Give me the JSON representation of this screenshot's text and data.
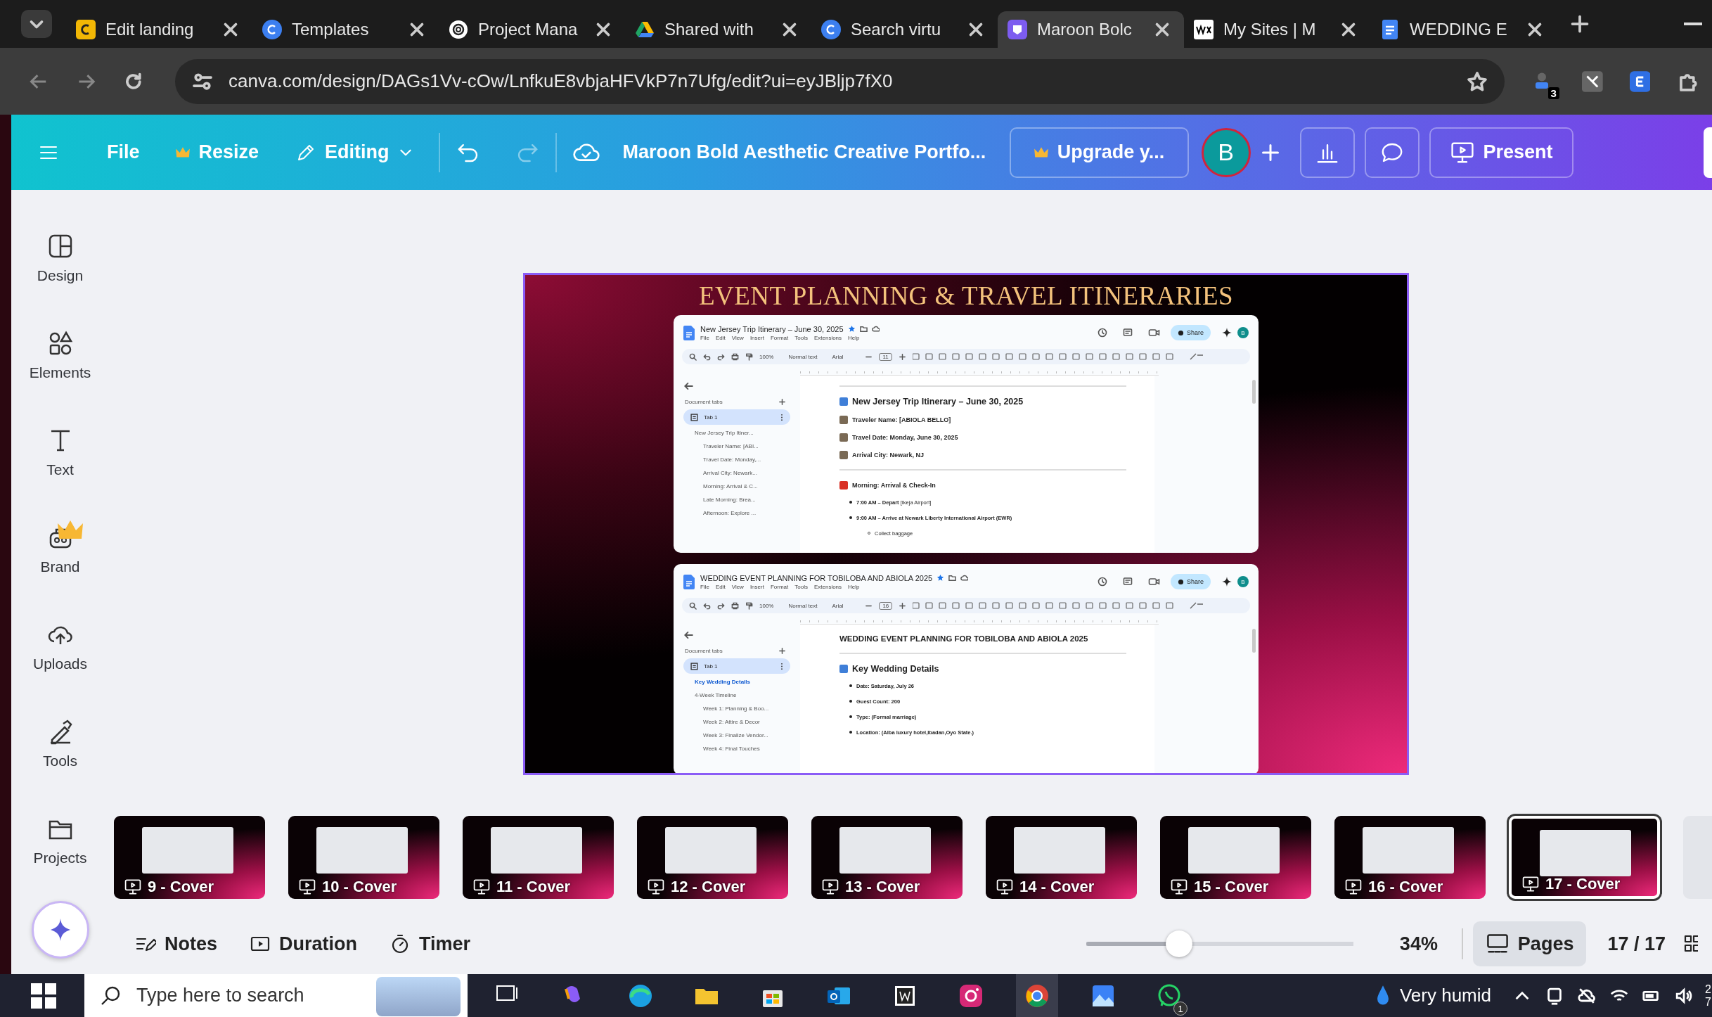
{
  "browser": {
    "tabs": [
      {
        "title": "Edit landing",
        "kind": "gold",
        "selected": false
      },
      {
        "title": "Templates",
        "kind": "canva",
        "selected": false
      },
      {
        "title": "Project Mana",
        "kind": "openai",
        "selected": false
      },
      {
        "title": "Shared with",
        "kind": "drive",
        "selected": false
      },
      {
        "title": "Search virtu",
        "kind": "canva",
        "selected": false
      },
      {
        "title": "Maroon Bolc",
        "kind": "design",
        "selected": true
      },
      {
        "title": "My Sites | M",
        "kind": "wix",
        "selected": false
      },
      {
        "title": "WEDDING E",
        "kind": "docs",
        "selected": false
      }
    ],
    "address": "canva.com/design/DAGs1Vv-cOw/LnfkuE8vbjaHFVkP7n7Ufg/edit?ui=eyJBljp7fX0",
    "extension_badge": "3"
  },
  "toolbar": {
    "file": "File",
    "resize": "Resize",
    "editing": "Editing",
    "title": "Maroon Bold Aesthetic Creative Portfo...",
    "upgrade": "Upgrade y...",
    "avatar": "B",
    "present": "Present"
  },
  "sidebar": {
    "items": [
      {
        "label": "Design",
        "kind": "design",
        "premium": false
      },
      {
        "label": "Elements",
        "kind": "elements",
        "premium": false
      },
      {
        "label": "Text",
        "kind": "text",
        "premium": false
      },
      {
        "label": "Brand",
        "kind": "brand",
        "premium": true
      },
      {
        "label": "Uploads",
        "kind": "uploads",
        "premium": false
      },
      {
        "label": "Tools",
        "kind": "tools",
        "premium": false
      },
      {
        "label": "Projects",
        "kind": "projects",
        "premium": false
      }
    ]
  },
  "slide": {
    "title": "EVENT PLANNING & TRAVEL ITINERARIES",
    "docs": [
      {
        "title": "New Jersey Trip Itinerary – June 30, 2025",
        "menu": [
          "File",
          "Edit",
          "View",
          "Insert",
          "Format",
          "Tools",
          "Extensions",
          "Help"
        ],
        "zoom": "100%",
        "style": "Normal text",
        "font": "Arial",
        "size": "11",
        "share": "Share",
        "avatar": "B",
        "tabs_header": "Document tabs",
        "tab": "Tab 1",
        "outline": [
          {
            "text": "New Jersey Trip Itiner...",
            "selected": false,
            "children": [
              {
                "text": "Traveler Name: [ABI...",
                "selected": false
              },
              {
                "text": "Travel Date: Monday,...",
                "selected": false
              },
              {
                "text": "Arrival City: Newark...",
                "selected": false
              },
              {
                "text": "Morning: Arrival & C...",
                "selected": false
              },
              {
                "text": "Late Morning: Brea...",
                "selected": false
              },
              {
                "text": "Afternoon: Explore ...",
                "selected": false
              }
            ]
          }
        ],
        "body": [
          {
            "kind": "rule"
          },
          {
            "kind": "heading",
            "text": "New Jersey Trip Itinerary – June 30, 2025"
          },
          {
            "kind": "field",
            "text": "Traveler Name: [ABIOLA BELLO]"
          },
          {
            "kind": "field",
            "text": "Travel Date: Monday, June 30, 2025"
          },
          {
            "kind": "field",
            "text": "Arrival City: Newark, NJ"
          },
          {
            "kind": "rule"
          },
          {
            "kind": "section",
            "text": "Morning: Arrival & Check-In"
          },
          {
            "kind": "bullet",
            "text": "**7:00 AM – Depart** [Ikeja Airport]"
          },
          {
            "kind": "bullet",
            "text": "**9:00 AM – Arrive at Newark Liberty International Airport (EWR)**"
          },
          {
            "kind": "subbullet",
            "text": "Collect baggage"
          }
        ]
      },
      {
        "title": "WEDDING EVENT PLANNING FOR TOBILOBA AND ABIOLA 2025",
        "menu": [
          "File",
          "Edit",
          "View",
          "Insert",
          "Format",
          "Tools",
          "Extensions",
          "Help"
        ],
        "zoom": "100%",
        "style": "Normal text",
        "font": "Arial",
        "size": "16",
        "share": "Share",
        "avatar": "B",
        "tabs_header": "Document tabs",
        "tab": "Tab 1",
        "outline": [
          {
            "text": "Key Wedding Details",
            "selected": true
          },
          {
            "text": "4-Week Timeline",
            "selected": false,
            "children": [
              {
                "text": "Week 1: Planning & Boo...",
                "selected": false
              },
              {
                "text": "Week 2: Attire & Decor",
                "selected": false
              },
              {
                "text": "Week 3: Finalize Vendor...",
                "selected": false
              },
              {
                "text": "Week 4: Final Touches",
                "selected": false
              }
            ]
          }
        ],
        "body": [
          {
            "kind": "title",
            "text": "WEDDING EVENT PLANNING FOR TOBILOBA AND ABIOLA 2025"
          },
          {
            "kind": "rule"
          },
          {
            "kind": "heading",
            "text": "Key Wedding Details"
          },
          {
            "kind": "bullet",
            "text": "**Date: Saturday, July 26**"
          },
          {
            "kind": "bullet",
            "text": "**Guest Count: 200**"
          },
          {
            "kind": "bullet",
            "text": "**Type: (Formal marriage)**"
          },
          {
            "kind": "bullet",
            "text": "**Location: (Alba luxury hotel,Ibadan,Oyo State.)**"
          }
        ]
      }
    ]
  },
  "pages": [
    {
      "label": "9 - Cover",
      "selected": false
    },
    {
      "label": "10 - Cover",
      "selected": false
    },
    {
      "label": "11 - Cover",
      "selected": false
    },
    {
      "label": "12 - Cover",
      "selected": false
    },
    {
      "label": "13 - Cover",
      "selected": false
    },
    {
      "label": "14 - Cover",
      "selected": false
    },
    {
      "label": "15 - Cover",
      "selected": false
    },
    {
      "label": "16 - Cover",
      "selected": false
    },
    {
      "label": "17 - Cover",
      "selected": true
    }
  ],
  "bottom_bar": {
    "notes": "Notes",
    "duration": "Duration",
    "timer": "Timer",
    "zoom": {
      "level": 0.33
    },
    "zoom_reading": "34%",
    "pages": "Pages",
    "page_count": "17 / 17"
  },
  "taskbar": {
    "search_placeholder": "Type here to search",
    "whatsapp_badge": "1",
    "weather": "Very humid",
    "clock": [
      "2",
      "7"
    ]
  }
}
